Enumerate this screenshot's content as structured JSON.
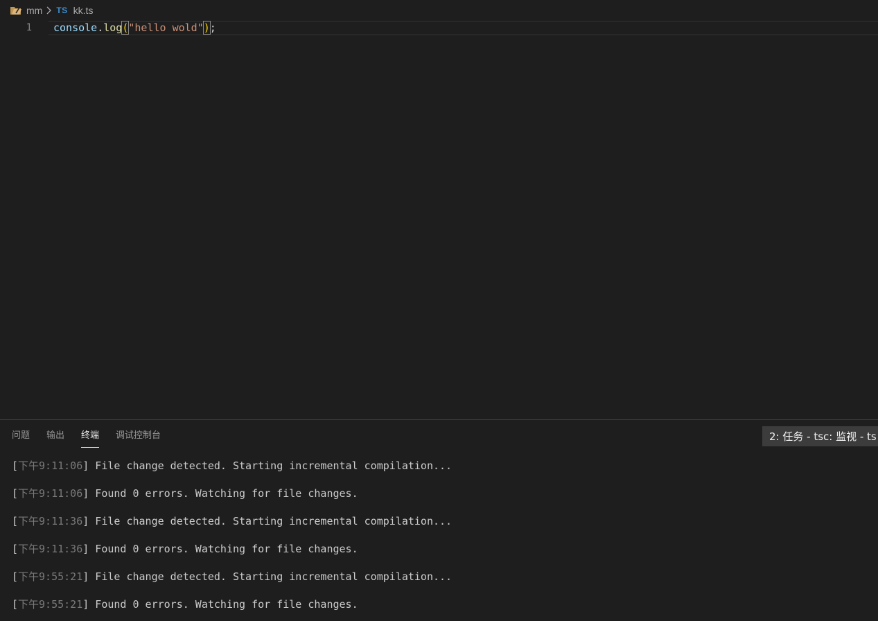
{
  "breadcrumb": {
    "folder": "mm",
    "file_lang": "TS",
    "file": "kk.ts"
  },
  "editor": {
    "line_number": "1",
    "tokens": {
      "object": "console",
      "dot": ".",
      "method": "log",
      "open_paren": "(",
      "string": "\"hello wold\"",
      "close_paren": ")",
      "semicolon": ";"
    }
  },
  "panel": {
    "tabs": [
      {
        "label": "问题"
      },
      {
        "label": "输出"
      },
      {
        "label": "终端"
      },
      {
        "label": "调试控制台"
      }
    ],
    "task_select": "2: 任务 - tsc: 监视 - ts"
  },
  "terminal": {
    "lines": [
      {
        "time": "下午9:11:06",
        "message": " File change detected. Starting incremental compilation..."
      },
      {
        "time": "下午9:11:06",
        "message": " Found 0 errors. Watching for file changes."
      },
      {
        "time": "下午9:11:36",
        "message": " File change detected. Starting incremental compilation..."
      },
      {
        "time": "下午9:11:36",
        "message": " Found 0 errors. Watching for file changes."
      },
      {
        "time": "下午9:55:21",
        "message": " File change detected. Starting incremental compilation..."
      },
      {
        "time": "下午9:55:21",
        "message": " Found 0 errors. Watching for file changes."
      }
    ]
  },
  "colors": {
    "background": "#1e1e1e",
    "ts_icon": "#3f8fd2",
    "string": "#ce9178",
    "variable": "#9cdcfe",
    "function": "#dcdcaa"
  },
  "icons": {
    "folder": "folder-icon",
    "chevron": "chevron-right-icon"
  }
}
